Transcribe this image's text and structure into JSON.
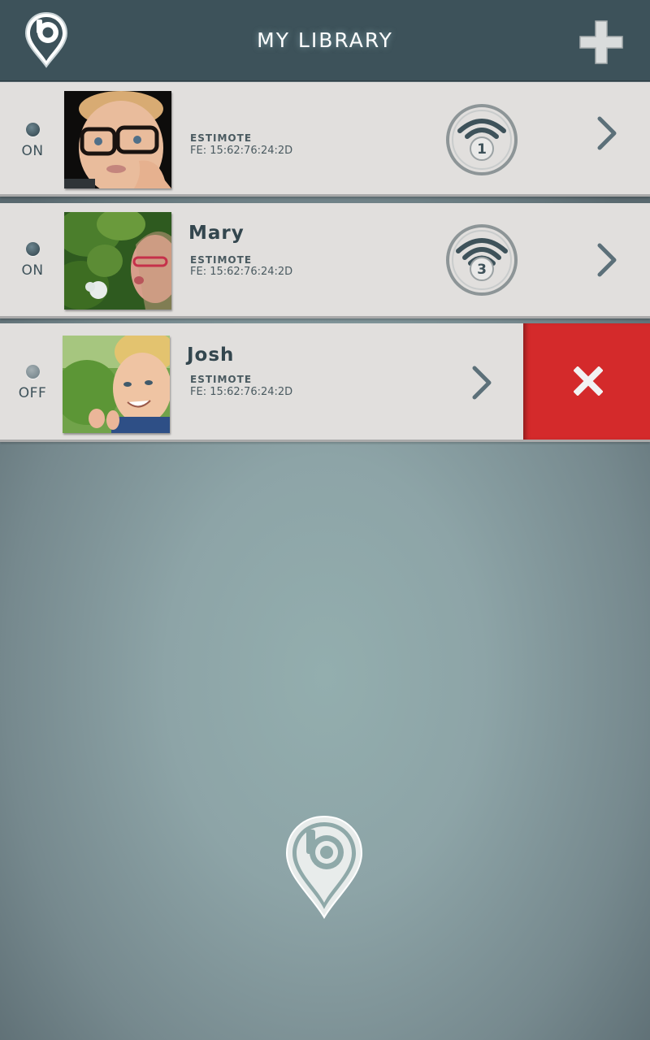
{
  "header": {
    "title": "MY LIBRARY",
    "logo_icon": "location-pin-b-logo-icon",
    "add_icon": "plus-icon"
  },
  "beacons": [
    {
      "status": "ON",
      "name": "",
      "device": "ESTIMOTE",
      "address": "FE: 15:62:76:24:2D",
      "signal_level": "1",
      "photo": "boy-with-glasses-photo"
    },
    {
      "status": "ON",
      "name": "Mary",
      "device": "ESTIMOTE",
      "address": "FE: 15:62:76:24:2D",
      "signal_level": "3",
      "photo": "girl-blowing-dandelion-photo"
    },
    {
      "status": "OFF",
      "name": "Josh",
      "device": "ESTIMOTE",
      "address": "FE: 15:62:76:24:2D",
      "photo": "smiling-blond-boy-photo",
      "delete_icon": "close-x-icon"
    }
  ],
  "colors": {
    "header_bg": "#3d525a",
    "row_bg": "#e1dfdd",
    "delete_bg": "#d42a2b",
    "accent": "#3e525a"
  }
}
